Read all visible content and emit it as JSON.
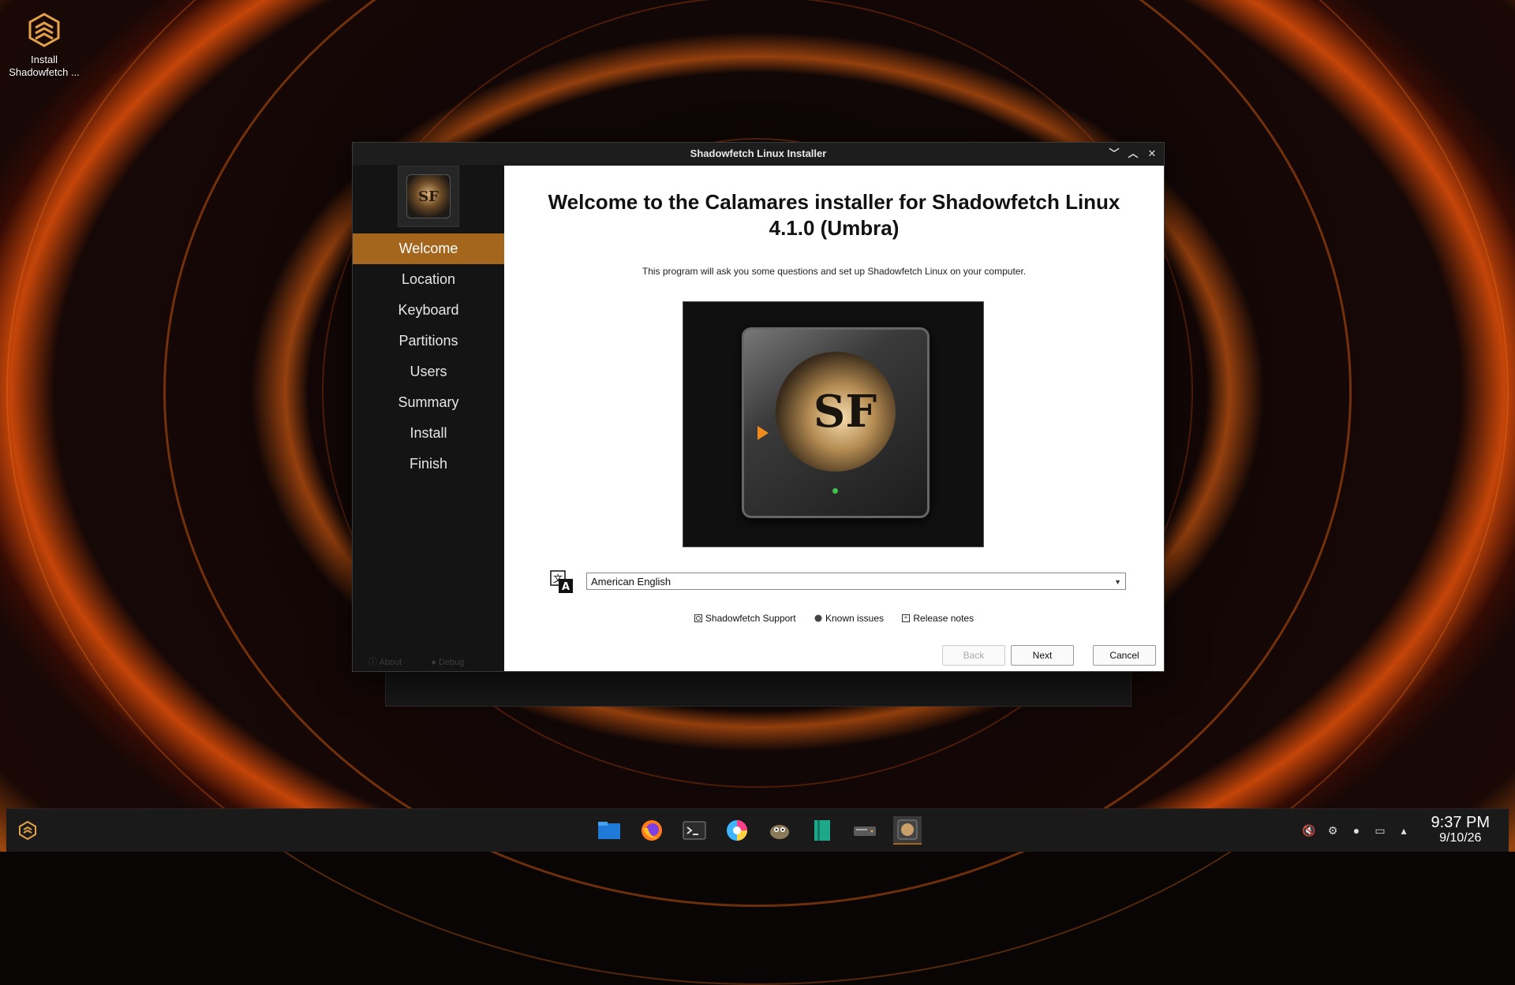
{
  "desktop": {
    "icon_label_line1": "Install",
    "icon_label_line2": "Shadowfetch ..."
  },
  "window": {
    "title": "Shadowfetch Linux Installer",
    "controls": {
      "minimize": "﹀",
      "maximize": "︿",
      "close": "✕"
    }
  },
  "sidebar": {
    "logo_text": "SF",
    "steps": [
      {
        "label": "Welcome"
      },
      {
        "label": "Location"
      },
      {
        "label": "Keyboard"
      },
      {
        "label": "Partitions"
      },
      {
        "label": "Users"
      },
      {
        "label": "Summary"
      },
      {
        "label": "Install"
      },
      {
        "label": "Finish"
      }
    ],
    "footer": {
      "about": "About",
      "debug": "Debug"
    }
  },
  "welcome": {
    "heading": "Welcome to the Calamares installer for Shadowfetch Linux 4.1.0 (Umbra)",
    "subtext": "This program will ask you some questions and set up Shadowfetch Linux on your computer.",
    "hero_text": "SF",
    "language": {
      "selected": "American English",
      "arrow": "▼"
    },
    "links": {
      "support": "Shadowfetch Support",
      "known_issues": "Known issues",
      "release_notes": "Release notes"
    }
  },
  "buttons": {
    "back": "Back",
    "next": "Next",
    "cancel": "Cancel"
  },
  "taskbar": {
    "clock_time": "9:37 PM",
    "clock_date": "9/10/26"
  },
  "colors": {
    "accent": "#a4661d",
    "wallpaper_glow": "#ff6a14"
  }
}
